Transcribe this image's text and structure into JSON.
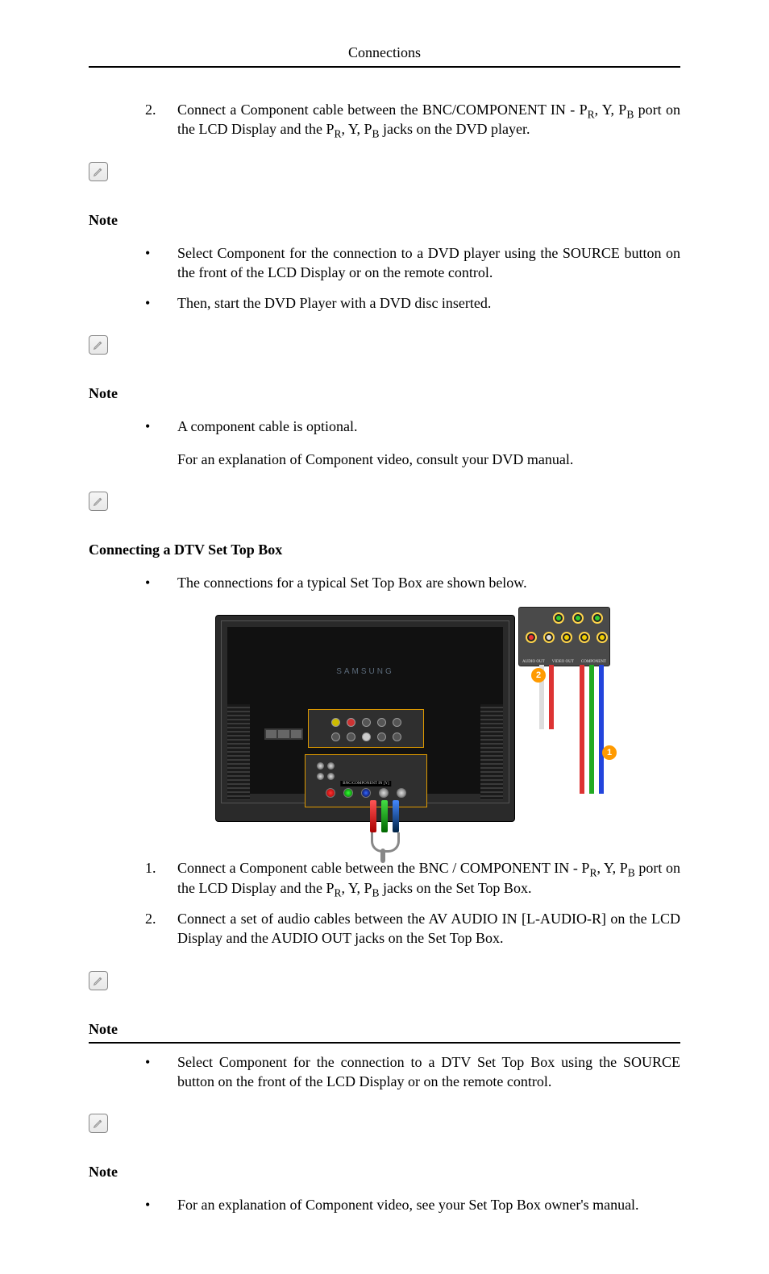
{
  "header": {
    "title": "Connections"
  },
  "step2_prefix": "Connect a Component cable between the BNC/COMPONENT IN - P",
  "step2_mid1": ", Y, P",
  "step2_mid2": " port on the LCD Display and the P",
  "step2_mid3": ", Y, P",
  "step2_suffix": " jacks on the DVD player.",
  "sub_R": "R",
  "sub_B": "B",
  "bullets_a": [
    "Select Component for the connection to a DVD player using the SOURCE button on the front of the LCD Display or on the remote control.",
    "Then, start the DVD Player with a DVD disc inserted."
  ],
  "bullet_b1": "A component cable is optional.",
  "bullet_b1_sub": "For an explanation of Component video, consult your DVD manual.",
  "section_title": "Connecting a DTV Set Top Box",
  "bullet_c1": "The connections for a typical Set Top Box are shown below.",
  "figure": {
    "brand": "SAMSUNG",
    "bnc_label": "BNC/COMPONENT IN [Y]",
    "stb_labels": [
      "AUDIO OUT",
      "VIDEO OUT",
      "COMPONENT"
    ],
    "callout1": "1",
    "callout2": "2"
  },
  "stepC1_prefix": "Connect a Component cable between the BNC / COMPONENT IN - P",
  "stepC1_mid1": ", Y, P",
  "stepC1_mid2": " port on the LCD Display and the P",
  "stepC1_mid3": ", Y, P",
  "stepC1_suffix": " jacks on the Set Top Box.",
  "stepC2": "Connect a set of audio cables between the AV AUDIO IN [L-AUDIO-R] on the LCD Display and the AUDIO OUT jacks on the Set Top Box.",
  "bullet_d1": "Select Component for the connection to a DTV Set Top Box using the SOURCE button on the front of the LCD Display or on the remote control.",
  "bullet_e1": "For an explanation of Component video, see your Set Top Box owner's manual.",
  "numbers": {
    "n1": "1.",
    "n2": "2."
  },
  "bullet_char": "•"
}
